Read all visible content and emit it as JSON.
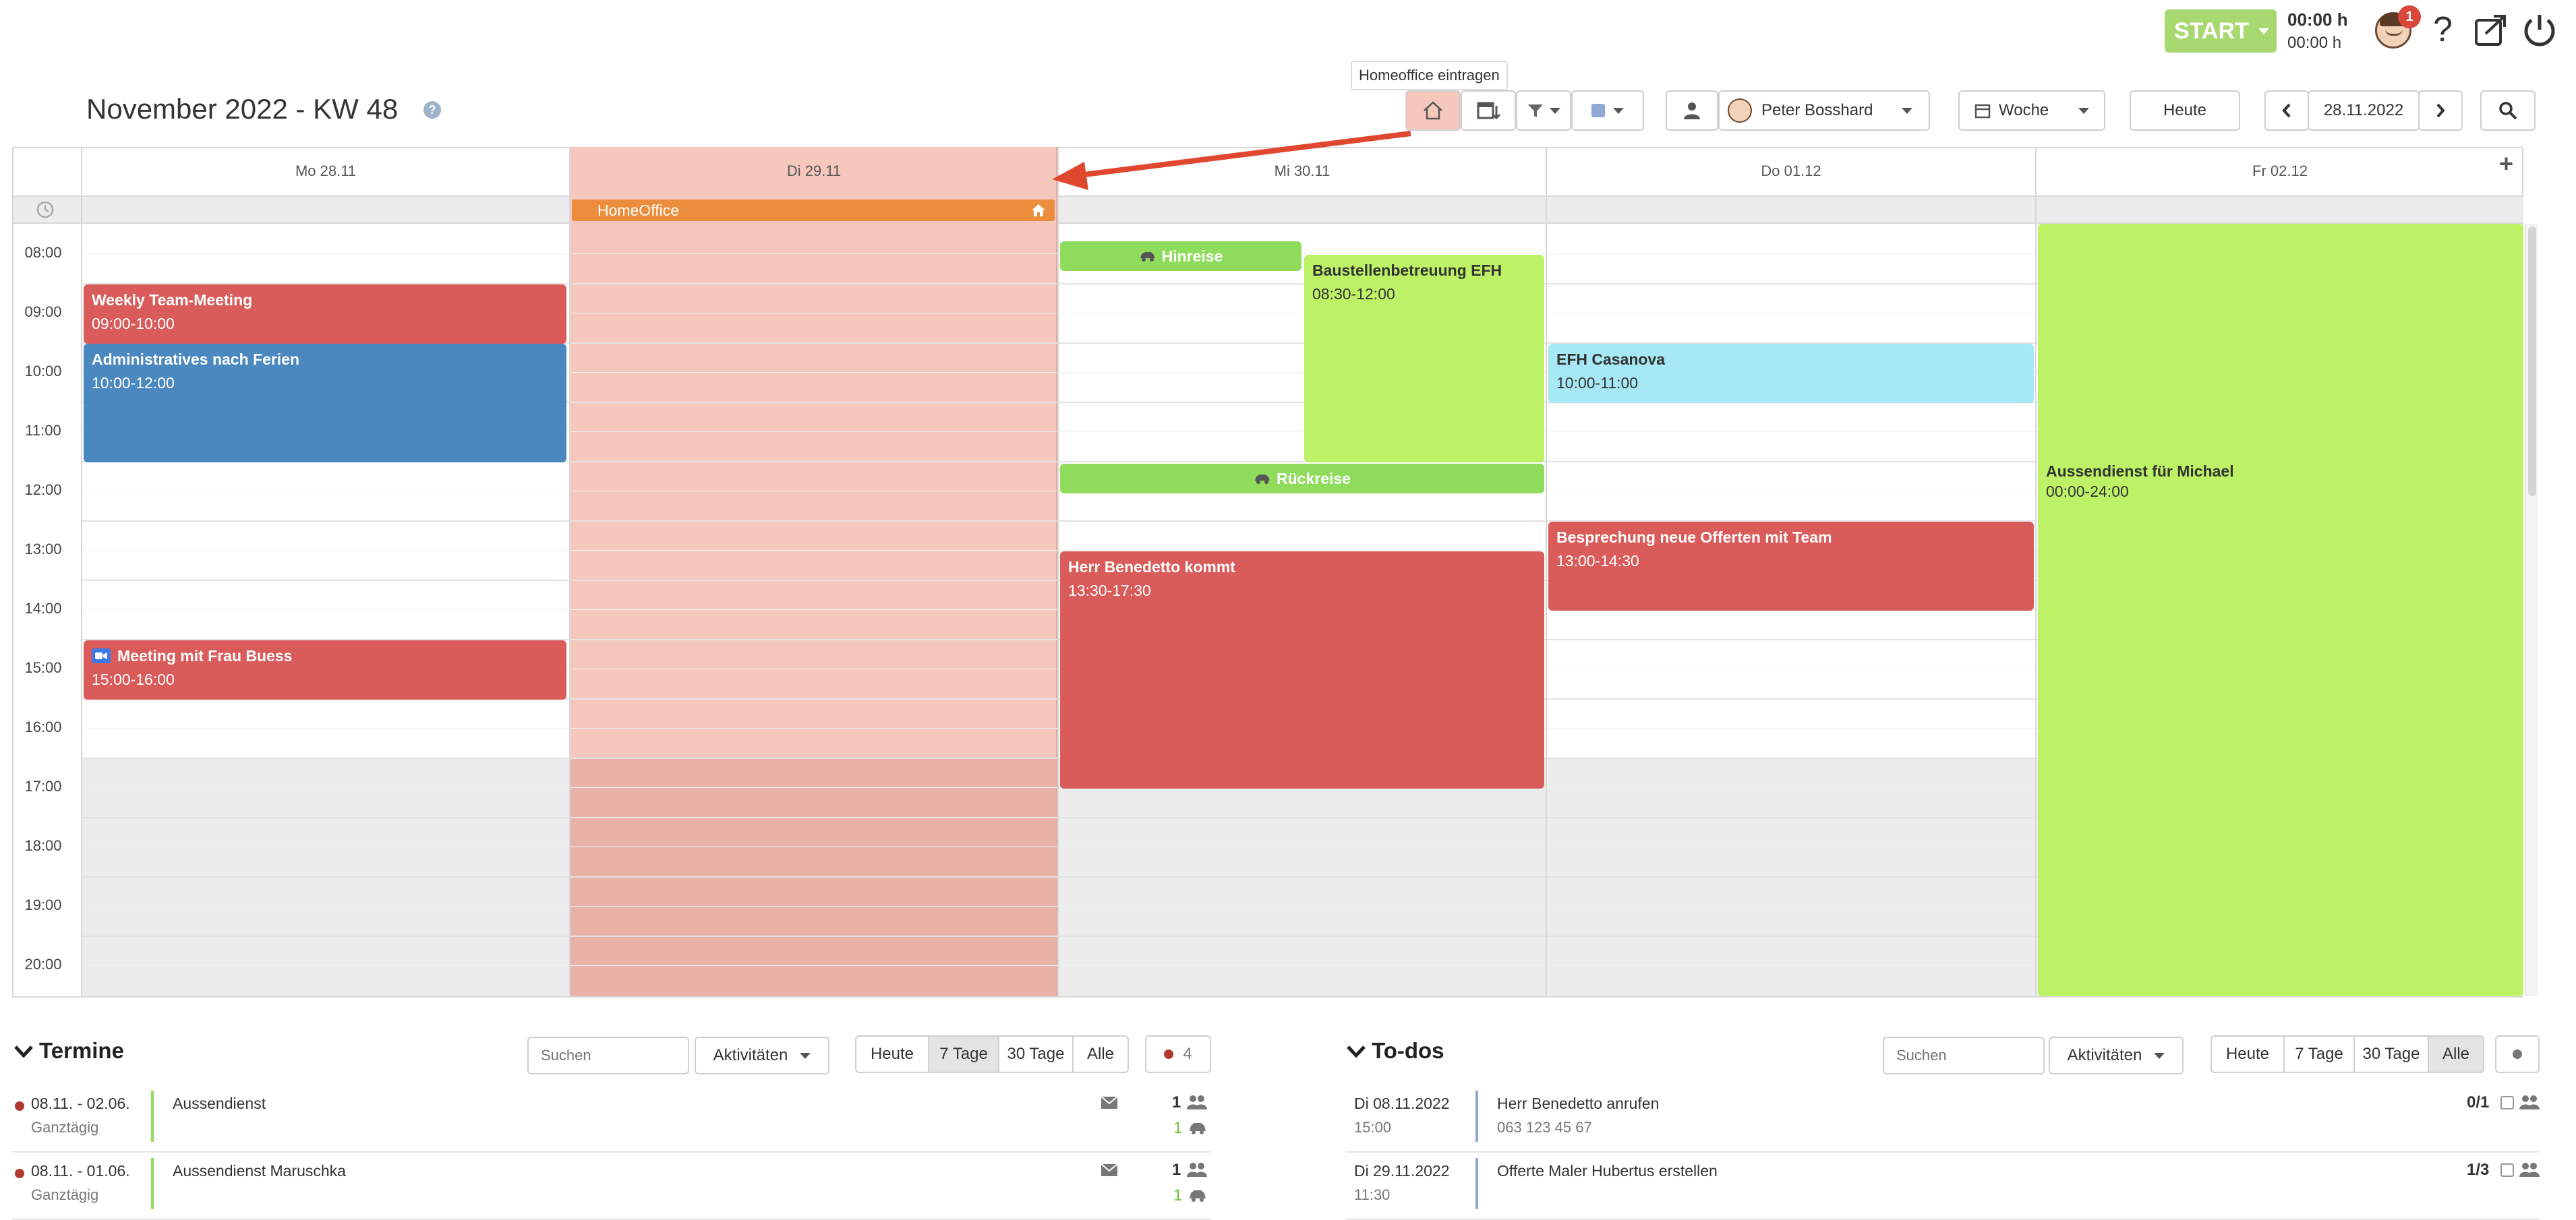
{
  "header": {
    "start_label": "START",
    "time_1": "00:00 h",
    "time_2": "00:00 h",
    "notification_count": "1",
    "help": "?"
  },
  "toolbar": {
    "title": "November 2022 - KW 48",
    "tooltip": "Homeoffice eintragen",
    "user": "Peter Bosshard",
    "view": "Woche",
    "today": "Heute",
    "date": "28.11.2022"
  },
  "days": [
    {
      "label": "Mo 28.11"
    },
    {
      "label": "Di 29.11"
    },
    {
      "label": "Mi 30.11"
    },
    {
      "label": "Do 01.12"
    },
    {
      "label": "Fr 02.12"
    }
  ],
  "allday": {
    "homeoffice": "HomeOffice"
  },
  "times": [
    "08:00",
    "09:00",
    "10:00",
    "11:00",
    "12:00",
    "13:00",
    "14:00",
    "15:00",
    "16:00",
    "17:00",
    "18:00",
    "19:00",
    "20:00"
  ],
  "events": {
    "weekly": {
      "title": "Weekly Team-Meeting",
      "time": "09:00-10:00"
    },
    "admin": {
      "title": "Administratives nach Ferien",
      "time": "10:00-12:00"
    },
    "buess": {
      "title": "Meeting mit Frau Buess",
      "time": "15:00-16:00"
    },
    "hinreise": {
      "title": "Hinreise"
    },
    "baustelle": {
      "title": "Baustellenbetreuung EFH",
      "time": "08:30-12:00"
    },
    "rueckreise": {
      "title": "Rückreise"
    },
    "benedetto": {
      "title": "Herr Benedetto kommt",
      "time": "13:30-17:30"
    },
    "casanova": {
      "title": "EFH Casanova",
      "time": "10:00-11:00"
    },
    "offerten": {
      "title": "Besprechung neue Offerten mit Team",
      "time": "13:00-14:30"
    },
    "aussendienst": {
      "title": "Aussendienst für Michael",
      "time": "00:00-24:00"
    }
  },
  "termine": {
    "title": "Termine",
    "search_placeholder": "Suchen",
    "activities": "Aktivitäten",
    "filters": [
      "Heute",
      "7 Tage",
      "30 Tage",
      "Alle"
    ],
    "count": "4",
    "rows": [
      {
        "date": "08.11. - 02.06.",
        "sub": "Ganztägig",
        "name": "Aussendienst",
        "n1": "1",
        "n2": "1"
      },
      {
        "date": "08.11. - 01.06.",
        "sub": "Ganztägig",
        "name": "Aussendienst Maruschka",
        "n1": "1",
        "n2": "1"
      }
    ]
  },
  "todos": {
    "title": "To-dos",
    "search_placeholder": "Suchen",
    "activities": "Aktivitäten",
    "filters": [
      "Heute",
      "7 Tage",
      "30 Tage",
      "Alle"
    ],
    "rows": [
      {
        "date": "Di 08.11.2022",
        "sub": "15:00",
        "name": "Herr Benedetto anrufen",
        "phone": "063 123 45 67",
        "progress": "0/1"
      },
      {
        "date": "Di 29.11.2022",
        "sub": "11:30",
        "name": "Offerte Maler Hubertus erstellen",
        "phone": "",
        "progress": "1/3"
      }
    ]
  },
  "colors": {
    "red": "#d95c5a",
    "blue": "#4a88bf",
    "green": "#bdf266",
    "cyan": "#a6e8f5",
    "orange": "#eb8d3c",
    "highlight": "#f6c7bd"
  }
}
